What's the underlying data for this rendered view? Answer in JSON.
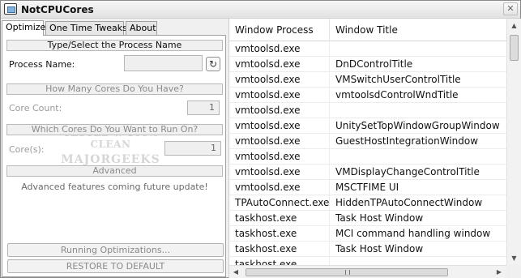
{
  "window": {
    "title": "NotCPUCores",
    "close_glyph": "✕"
  },
  "tabs": [
    {
      "label": "Optimize",
      "active": true
    },
    {
      "label": "One Time Tweaks",
      "active": false
    },
    {
      "label": "About",
      "active": false
    }
  ],
  "optimize": {
    "section_process": "Type/Select the Process Name",
    "process_label": "Process Name:",
    "process_value": "",
    "refresh_glyph": "↻",
    "section_cores": "How Many Cores Do You Have?",
    "core_count_label": "Core Count:",
    "core_count_value": "1",
    "section_which": "Which Cores Do You Want to Run On?",
    "cores_label": "Core(s):",
    "cores_value": "1",
    "section_advanced": "Advanced",
    "advanced_text": "Advanced features coming future update!",
    "running_button": "Running Optimizations...",
    "restore_button": "RESTORE TO DEFAULT"
  },
  "watermark": {
    "line1": "TESTED ★ 100% CLEAN",
    "line2": "MAJORGEEKS",
    "line3": "★★★★★★"
  },
  "process_list": {
    "columns": [
      "Window Process",
      "Window Title"
    ],
    "rows": [
      [
        "vmtoolsd.exe",
        ""
      ],
      [
        "vmtoolsd.exe",
        "DnDControlTitle"
      ],
      [
        "vmtoolsd.exe",
        "VMSwitchUserControlTitle"
      ],
      [
        "vmtoolsd.exe",
        "vmtoolsdControlWndTitle"
      ],
      [
        "vmtoolsd.exe",
        ""
      ],
      [
        "vmtoolsd.exe",
        "UnitySetTopWindowGroupWindow"
      ],
      [
        "vmtoolsd.exe",
        "GuestHostIntegrationWindow"
      ],
      [
        "vmtoolsd.exe",
        ""
      ],
      [
        "vmtoolsd.exe",
        "VMDisplayChangeControlTitle"
      ],
      [
        "vmtoolsd.exe",
        "MSCTFIME UI"
      ],
      [
        "TPAutoConnect.exe",
        "HiddenTPAutoConnectWindow"
      ],
      [
        "taskhost.exe",
        "Task Host Window"
      ],
      [
        "taskhost.exe",
        "MCI command handling window"
      ],
      [
        "taskhost.exe",
        "Task Host Window"
      ],
      [
        "taskhost.exe",
        ""
      ]
    ]
  },
  "scroll": {
    "up": "▲",
    "down": "▼",
    "left": "◀",
    "right": "▶"
  }
}
